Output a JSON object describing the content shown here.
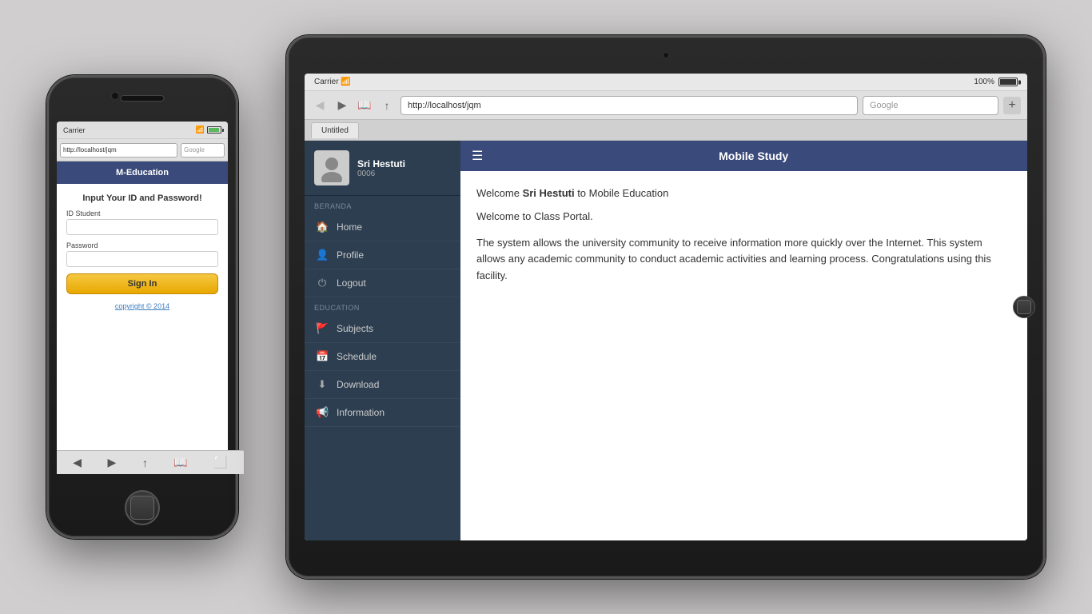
{
  "iphone": {
    "status": {
      "carrier": "Carrier",
      "wifi": "📶",
      "battery_color": "#5cb85c"
    },
    "url_bar": {
      "url": "http://localhost/jqm",
      "google_placeholder": "Google"
    },
    "app_header": "M-Education",
    "login_title": "Input Your ID and Password!",
    "id_label": "ID Student",
    "password_label": "Password",
    "signin_button": "Sign In",
    "copyright": "copyright © 2014",
    "bottom_icons": [
      "◀",
      "▶",
      "↑",
      "📖",
      "⬜"
    ]
  },
  "ipad": {
    "status": {
      "carrier": "Carrier",
      "wifi": "📶",
      "battery_pct": "100%"
    },
    "browser": {
      "url": "http://localhost/jqm",
      "google_placeholder": "Google",
      "tab_label": "Untitled",
      "plus": "+"
    },
    "sidebar": {
      "user_name": "Sri Hestuti",
      "user_id": "0006",
      "section1": "Beranda",
      "nav_items": [
        {
          "icon": "🏠",
          "label": "Home"
        },
        {
          "icon": "👤",
          "label": "Profile"
        },
        {
          "icon": "⏻",
          "label": "Logout"
        }
      ],
      "section2": "Education",
      "edu_items": [
        {
          "icon": "🚩",
          "label": "Subjects"
        },
        {
          "icon": "📅",
          "label": "Schedule"
        },
        {
          "icon": "⬇",
          "label": "Download"
        },
        {
          "icon": "📢",
          "label": "Information"
        }
      ]
    },
    "app_header": "Mobile Study",
    "main": {
      "welcome_line": "Welcome Sri Hestuti to Mobile Education",
      "welcome_name": "Sri Hestuti",
      "portal_line": "Welcome to Class Portal.",
      "body_text": "The system allows the university community to receive information more quickly over the Internet. This system allows any academic community to conduct academic activities and learning process. Congratulations using this facility."
    }
  }
}
